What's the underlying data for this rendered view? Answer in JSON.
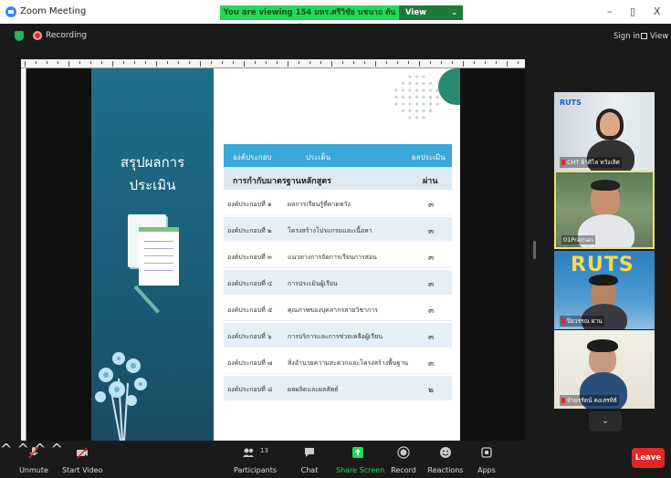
{
  "window": {
    "title": "Zoom Meeting",
    "viewing_banner": "You are viewing 154 มหร.ศรีวิชัย นชนาถ ต้นตร...'s screen",
    "view_options": "View Options",
    "minimize": "–",
    "restore": "▯",
    "close": "X"
  },
  "status": {
    "recording": "Recording",
    "sign_in": "Sign in",
    "view": "View"
  },
  "slide": {
    "title_line1": "สรุปผลการ",
    "title_line2": "ประเมิน",
    "table": {
      "headers": [
        "องค์ประกอบ",
        "ประเด็น",
        "ผลประเมิน"
      ],
      "group_label": "การกำกับมาตรฐานหลักสูตร",
      "group_result": "ผ่าน",
      "rows": [
        {
          "component": "องค์ประกอบที่ ๑",
          "issue": "ผลการเรียนรู้ที่คาดหวัง",
          "result": "๓"
        },
        {
          "component": "องค์ประกอบที่ ๒",
          "issue": "โครงสร้างโปรแกรมและเนื้อหา",
          "result": "๓"
        },
        {
          "component": "องค์ประกอบที่ ๓",
          "issue": "แนวทางการจัดการเรียนการสอน",
          "result": "๓"
        },
        {
          "component": "องค์ประกอบที่ ๔",
          "issue": "การประเมินผู้เรียน",
          "result": "๓"
        },
        {
          "component": "องค์ประกอบที่ ๕",
          "issue": "คุณภาพของบุคลากรสายวิชาการ",
          "result": "๓"
        },
        {
          "component": "องค์ประกอบที่ ๖",
          "issue": "การบริการและการช่วยเหลือผู้เรียน",
          "result": "๓"
        },
        {
          "component": "องค์ประกอบที่ ๗",
          "issue": "สิ่งอำนวยความสะดวกและโครงสร้างพื้นฐาน",
          "result": "๓"
        },
        {
          "component": "องค์ประกอบที่ ๘",
          "issue": "ผลผลิตและผลลัพธ์",
          "result": "๒"
        }
      ]
    }
  },
  "participants": [
    {
      "name": "CHT ผ้าศิไล หวังเลิศ",
      "logo": "RUTS"
    },
    {
      "name": "01Praman"
    },
    {
      "name": "ปิยวรรณ ผ่าน",
      "logo": "RUTS"
    },
    {
      "name": "จำมรรัตน์ คงเสรทิธ์"
    }
  ],
  "toolbar": {
    "unmute": "Unmute",
    "start_video": "Start Video",
    "participants": "Participants",
    "participant_count": "13",
    "chat": "Chat",
    "share_screen": "Share Screen",
    "record": "Record",
    "reactions": "Reactions",
    "apps": "Apps",
    "leave": "Leave"
  },
  "colors": {
    "share_green": "#23d959",
    "leave_red": "#e02828",
    "table_header": "#3aa8d8",
    "slide_teal": "#1e6f8a",
    "active_speaker": "#f0e26a"
  }
}
